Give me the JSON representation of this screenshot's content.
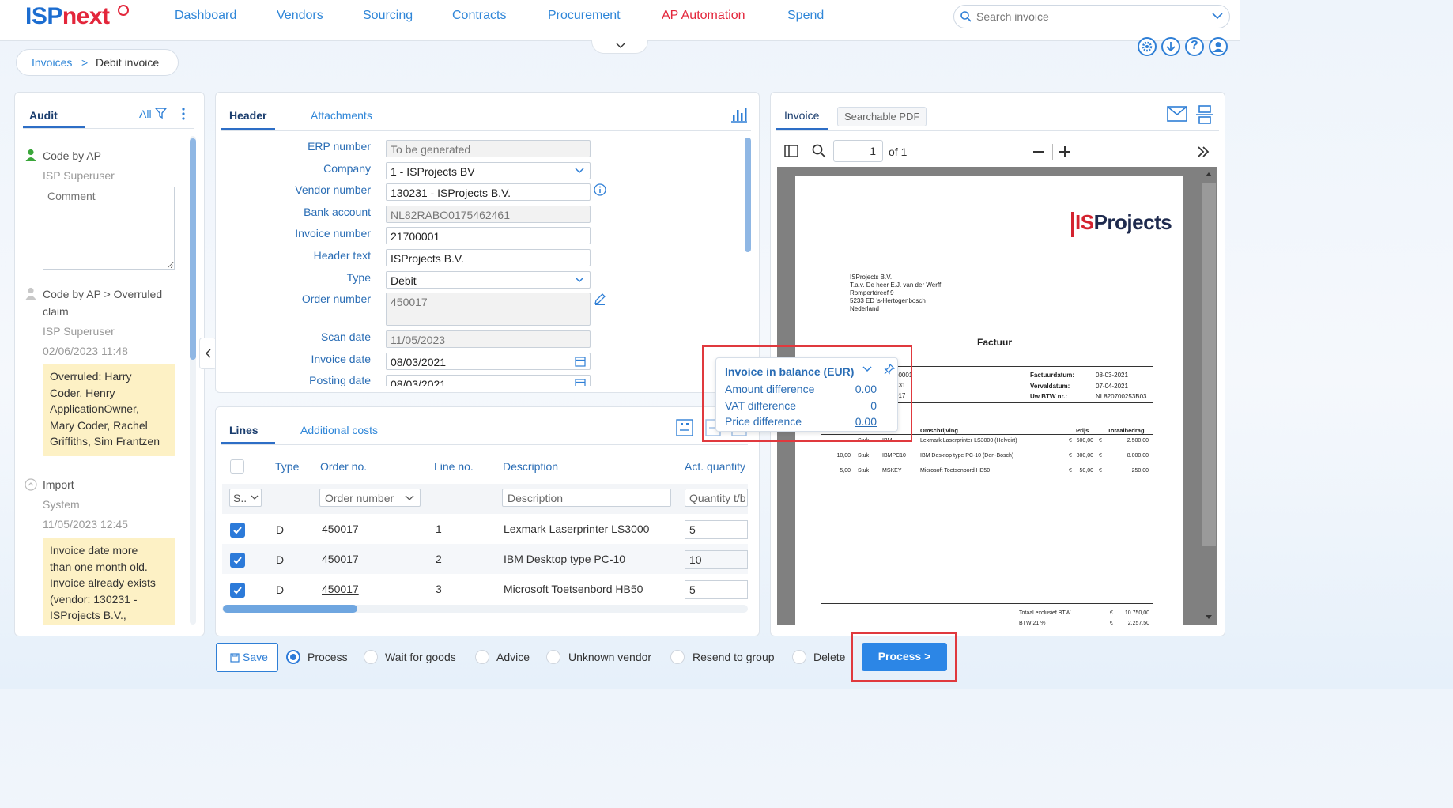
{
  "brand": {
    "logo_isp": "ISP",
    "logo_next": "next"
  },
  "nav": {
    "items": [
      "Dashboard",
      "Vendors",
      "Sourcing",
      "Contracts",
      "Procurement",
      "AP Automation",
      "Spend"
    ],
    "active": "AP Automation",
    "search_placeholder": "Search invoice"
  },
  "breadcrumb": {
    "parent": "Invoices",
    "separator": ">",
    "current": "Debit invoice"
  },
  "audit": {
    "tab": "Audit",
    "filter_label": "All",
    "entries": [
      {
        "title": "Code by AP",
        "user": "ISP Superuser",
        "comment_placeholder": "Comment"
      },
      {
        "title_line1": "Code by AP > Overruled",
        "title_line2": "claim",
        "user": "ISP Superuser",
        "timestamp": "02/06/2023 11:48",
        "note": [
          "Overruled: Harry",
          "Coder, Henry",
          "ApplicationOwner,",
          "Mary Coder, Rachel",
          "Griffiths, Sim Frantzen"
        ]
      },
      {
        "title": "Import",
        "user": "System",
        "timestamp": "11/05/2023 12:45",
        "note": [
          "Invoice date more",
          "than one month old.",
          "Invoice already exists",
          "(vendor: 130231 -",
          "ISProjects B.V.,"
        ]
      }
    ]
  },
  "header_panel": {
    "tabs": [
      "Header",
      "Attachments"
    ],
    "fields": [
      {
        "label": "ERP number",
        "value": "To be generated"
      },
      {
        "label": "Company",
        "value": "1 - ISProjects BV"
      },
      {
        "label": "Vendor number",
        "value": "130231 - ISProjects B.V."
      },
      {
        "label": "Bank account",
        "value": "NL82RABO0175462461"
      },
      {
        "label": "Invoice number",
        "value": "21700001"
      },
      {
        "label": "Header text",
        "value": "ISProjects B.V."
      },
      {
        "label": "Type",
        "value": "Debit"
      },
      {
        "label": "Order number",
        "value": "450017"
      },
      {
        "label": "Scan date",
        "value": "11/05/2023"
      },
      {
        "label": "Invoice date",
        "value": "08/03/2021"
      },
      {
        "label": "Posting date",
        "value": "08/03/2021"
      }
    ]
  },
  "lines_panel": {
    "tabs": [
      "Lines",
      "Additional costs"
    ],
    "columns": [
      "Type",
      "Order no.",
      "Line no.",
      "Description",
      "Act. quantity"
    ],
    "filters": {
      "select": "S..",
      "order": "Order number",
      "description": "Description",
      "quantity": "Quantity t/b"
    },
    "rows": [
      {
        "type": "D",
        "order": "450017",
        "line": "1",
        "description": "Lexmark Laserprinter LS3000",
        "qty": "5"
      },
      {
        "type": "D",
        "order": "450017",
        "line": "2",
        "description": "IBM Desktop type PC-10",
        "qty": "10"
      },
      {
        "type": "D",
        "order": "450017",
        "line": "3",
        "description": "Microsoft Toetsenbord HB50",
        "qty": "5"
      }
    ]
  },
  "invoice_panel": {
    "tabs": [
      "Invoice",
      "Searchable PDF"
    ],
    "page_input": "1",
    "page_of": "of 1"
  },
  "pdf": {
    "logo_is": "IS",
    "logo_projects": "Projects",
    "address": [
      "ISProjects B.V.",
      "T.a.v. De heer E.J. van der Werff",
      "Rompertdreef 9",
      "5233 ED  's-Hertogenbosch",
      "Nederland"
    ],
    "title": "Factuur",
    "meta": [
      {
        "k": "Factuurdatum:",
        "v": "08-03-2021"
      },
      {
        "k": "Vervaldatum:",
        "v": "07-04-2021"
      },
      {
        "k": "Uw BTW nr.:",
        "v": "NL820700253B03"
      }
    ],
    "left_nums": [
      "00001",
      "231",
      "017"
    ],
    "col_heads": {
      "desc": "Omschrijving",
      "price": "Prijs",
      "total": "Totaalbedrag"
    },
    "lines": [
      {
        "qty": "",
        "unit": "Stuk",
        "code": "IBML",
        "desc": "Lexmark Laserprinter LS3000 (Helvoirt)",
        "cur": "€",
        "price": "500,00",
        "cur2": "€",
        "total": "2.500,00"
      },
      {
        "qty": "10,00",
        "unit": "Stuk",
        "code": "IBMPC10",
        "desc": "IBM Desktop type PC-10 (Den-Bosch)",
        "cur": "€",
        "price": "800,00",
        "cur2": "€",
        "total": "8.000,00"
      },
      {
        "qty": "5,00",
        "unit": "Stuk",
        "code": "MSKEY",
        "desc": "Microsoft Toetsenbord HB50",
        "cur": "€",
        "price": "50,00",
        "cur2": "€",
        "total": "250,00"
      }
    ],
    "totals": [
      {
        "k": "Totaal exclusief BTW",
        "cur": "€",
        "v": "10.750,00"
      },
      {
        "k": "BTW 21 %",
        "cur": "€",
        "v": "2.257,50"
      }
    ]
  },
  "balance_popup": {
    "title": "Invoice in balance (EUR)",
    "rows": [
      {
        "label": "Amount difference",
        "value": "0.00"
      },
      {
        "label": "VAT difference",
        "value": "0"
      },
      {
        "label": "Price difference",
        "value": "0.00"
      }
    ]
  },
  "footer": {
    "save_label": "Save",
    "options": [
      "Process",
      "Wait for goods",
      "Advice",
      "Unknown vendor",
      "Resend to group",
      "Delete"
    ],
    "selected": "Process",
    "process_label": "Process >"
  }
}
